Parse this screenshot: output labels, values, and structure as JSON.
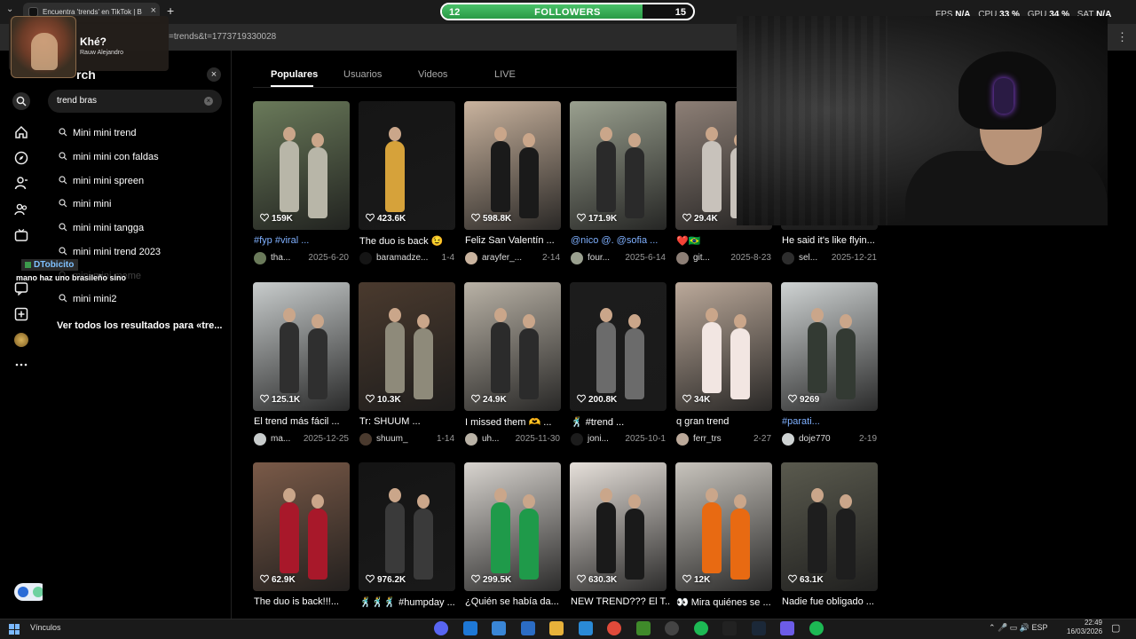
{
  "browser": {
    "tab_title": "Encuentra 'trends' en TikTok | B",
    "tab_close": "×",
    "new_tab": "+",
    "url_fragment": "=trends&t=1773719330028",
    "menu_icon": "⋮"
  },
  "overlay": {
    "followers": {
      "current": "12",
      "label": "FOLLOWERS",
      "goal": "15",
      "progress": 0.8
    },
    "stats": [
      {
        "label": "FPS",
        "value": "N/A"
      },
      {
        "label": "CPU",
        "value": "33 %"
      },
      {
        "label": "GPU",
        "value": "34 %"
      },
      {
        "label": "SAT",
        "value": "N/A"
      }
    ],
    "music": {
      "title": "Khé?",
      "artist": "Rauw Alejandro"
    },
    "chat": {
      "user": "DTobicito",
      "message": "mano haz uno brasileño sino"
    }
  },
  "search_panel": {
    "title": "rch",
    "close": "×",
    "query": "trend bras",
    "clear": "×",
    "suggestions": [
      "Mini mini trend",
      "mini mini con faldas",
      "mini mini spreen",
      "mini mini",
      "mini mini tangga",
      "mini mini trend 2023",
      "mini mini meme",
      "mini mini2"
    ],
    "see_all": "Ver todos los resultados para «tre..."
  },
  "category_tabs": [
    "Populares",
    "Usuarios",
    "Videos",
    "LIVE"
  ],
  "videos": [
    {
      "likes": "159K",
      "caption": "#fyp #viral ...",
      "user": "tha...",
      "date": "2025-6-20",
      "colors": [
        "#6a7a5a",
        "#b8b6a8"
      ]
    },
    {
      "likes": "423.6K",
      "caption": "The duo is back 😉",
      "user": "baramadze...",
      "date": "1-4",
      "colors": [
        "#151515",
        "#d6a23a"
      ]
    },
    {
      "likes": "598.8K",
      "caption": "Feliz San Valentín ...",
      "user": "arayfer_...",
      "date": "2-14",
      "colors": [
        "#c9b39e",
        "#1a1a1a"
      ]
    },
    {
      "likes": "171.9K",
      "caption": "@nico @. @sofia ...",
      "user": "four...",
      "date": "2025-6-14",
      "colors": [
        "#9aa08f",
        "#2a2a2a"
      ]
    },
    {
      "likes": "29.4K",
      "caption": "❤️🇧🇷",
      "user": "git...",
      "date": "2025-8-23",
      "colors": [
        "#8d7f76",
        "#c8c2bb"
      ]
    },
    {
      "likes": "",
      "caption": "He said it's like flyin...",
      "user": "sel...",
      "date": "2025-12-21",
      "colors": [
        "#2d2d2d",
        "#444"
      ]
    },
    {
      "likes": "125.1K",
      "caption": "El trend más fácil ...",
      "user": "ma...",
      "date": "2025-12-25",
      "colors": [
        "#c8cccc",
        "#2f2f2f"
      ]
    },
    {
      "likes": "10.3K",
      "caption": "Tr: SHUUM ...",
      "user": "shuum_",
      "date": "1-14",
      "colors": [
        "#4a3a2e",
        "#8e8a7a"
      ]
    },
    {
      "likes": "24.9K",
      "caption": "I missed them 🫶 ...",
      "user": "uh...",
      "date": "2025-11-30",
      "colors": [
        "#b9b2a6",
        "#2b2b2b"
      ]
    },
    {
      "likes": "200.8K",
      "caption": "🕺 #trend ...",
      "user": "joni...",
      "date": "2025-10-1",
      "colors": [
        "#1c1c1c",
        "#6b6b6b"
      ]
    },
    {
      "likes": "34K",
      "caption": "q gran trend",
      "user": "ferr_trs",
      "date": "2-27",
      "colors": [
        "#bba99a",
        "#f2e6e2"
      ]
    },
    {
      "likes": "9269",
      "caption": "#parati...",
      "user": "doje770",
      "date": "2-19",
      "colors": [
        "#cfd3d3",
        "#333a33"
      ]
    },
    {
      "likes": "62.9K",
      "caption": "The duo is back!!!...",
      "user": "",
      "date": "",
      "colors": [
        "#7a5a48",
        "#a8182a"
      ]
    },
    {
      "likes": "976.2K",
      "caption": "🕺🕺🕺 #humpday ...",
      "user": "",
      "date": "",
      "colors": [
        "#141414",
        "#3a3a3a"
      ]
    },
    {
      "likes": "299.5K",
      "caption": "¿Quién se había da...",
      "user": "",
      "date": "",
      "colors": [
        "#d8d4cf",
        "#1f9a4a"
      ]
    },
    {
      "likes": "630.3K",
      "caption": "NEW TREND??? El T...",
      "user": "",
      "date": "",
      "colors": [
        "#e6e0da",
        "#1a1a1a"
      ]
    },
    {
      "likes": "12K",
      "caption": "👀 Mira quiénes se ...",
      "user": "",
      "date": "",
      "colors": [
        "#c8c4bd",
        "#e86a12"
      ]
    },
    {
      "likes": "63.1K",
      "caption": "Nadie fue obligado ...",
      "user": "",
      "date": "",
      "colors": [
        "#5a5a4e",
        "#1e1e1e"
      ]
    }
  ],
  "taskbar": {
    "label": "Vínculos",
    "tray_lang": "ESP",
    "time": "22:49",
    "date": "16/03/2026"
  },
  "icons": {
    "search": "search-icon",
    "home": "home-icon",
    "explore": "compass-icon",
    "following": "user-follow-icon",
    "friends": "friends-icon",
    "live": "live-tv-icon",
    "messages": "message-icon",
    "upload": "upload-icon",
    "more": "more-icon"
  },
  "colors": {
    "accent": "#fe2c55",
    "followers_fill": "#3db35c",
    "link_blue": "#7fb0ff"
  }
}
